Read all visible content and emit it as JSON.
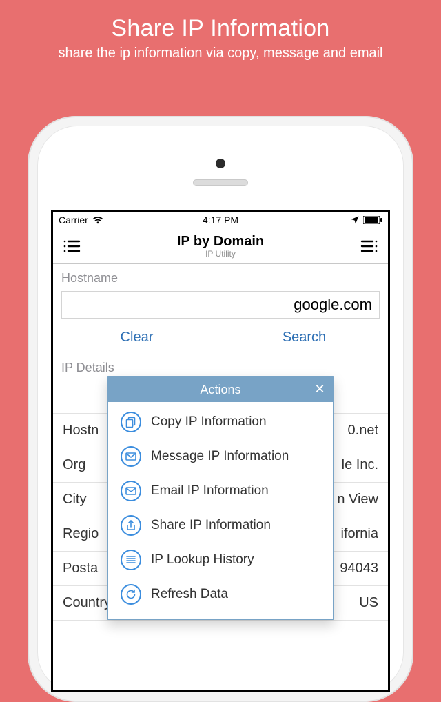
{
  "hero": {
    "title": "Share IP Information",
    "subtitle": "share the ip information via copy, message and email"
  },
  "statusbar": {
    "carrier": "Carrier",
    "time": "4:17 PM"
  },
  "nav": {
    "title": "IP by Domain",
    "subtitle": "IP Utility"
  },
  "hostname": {
    "label": "Hostname",
    "value": "google.com",
    "clear_label": "Clear",
    "search_label": "Search"
  },
  "ipdetails": {
    "label": "IP Details",
    "ip_value": "",
    "rows": [
      {
        "label": "Hostname",
        "value": "….net"
      },
      {
        "label": "Org",
        "value": "…le Inc."
      },
      {
        "label": "City",
        "value": "…n View"
      },
      {
        "label": "Region",
        "value": "…ifornia"
      },
      {
        "label": "Postal",
        "value": "94043"
      },
      {
        "label": "Country",
        "value": "US"
      }
    ]
  },
  "popup": {
    "title": "Actions",
    "items": [
      {
        "icon": "copy",
        "label": "Copy IP Information"
      },
      {
        "icon": "message",
        "label": "Message IP Information"
      },
      {
        "icon": "email",
        "label": "Email IP Information"
      },
      {
        "icon": "share",
        "label": "Share IP Information"
      },
      {
        "icon": "history",
        "label": "IP Lookup History"
      },
      {
        "icon": "refresh",
        "label": "Refresh Data"
      }
    ]
  }
}
